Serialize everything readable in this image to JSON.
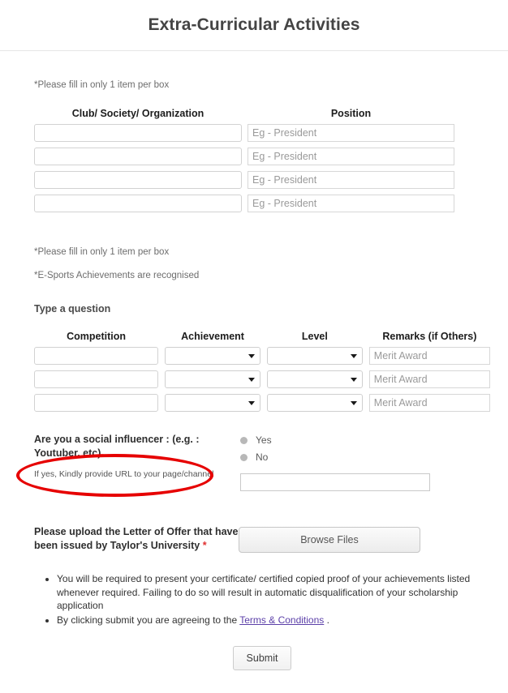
{
  "header": {
    "title": "Extra-Curricular Activities"
  },
  "notes": {
    "note1": "*Please fill in only 1 item per box",
    "note2": "*Please fill in only 1 item per box",
    "note3": "*E-Sports Achievements are recognised",
    "type_a_question": "Type a question"
  },
  "table_clubs": {
    "headers": [
      "Club/ Society/ Organization",
      "Position"
    ],
    "rows": [
      {
        "club": "",
        "club_placeholder": "",
        "position": "",
        "position_placeholder": "Eg - President"
      },
      {
        "club": "",
        "club_placeholder": "",
        "position": "",
        "position_placeholder": "Eg - President"
      },
      {
        "club": "",
        "club_placeholder": "",
        "position": "",
        "position_placeholder": "Eg - President"
      },
      {
        "club": "",
        "club_placeholder": "",
        "position": "",
        "position_placeholder": "Eg - President"
      }
    ]
  },
  "table_competitions": {
    "headers": [
      "Competition",
      "Achievement",
      "Level",
      "Remarks (if Others)"
    ],
    "rows": [
      {
        "competition": "",
        "achievement": "",
        "level": "",
        "remarks": "",
        "remarks_placeholder": "Merit Award"
      },
      {
        "competition": "",
        "achievement": "",
        "level": "",
        "remarks": "",
        "remarks_placeholder": "Merit Award"
      },
      {
        "competition": "",
        "achievement": "",
        "level": "",
        "remarks": "",
        "remarks_placeholder": "Merit Award"
      }
    ]
  },
  "influencer": {
    "question": "Are you a social influencer : (e.g. : Youtuber, etc)",
    "sub_label": "If yes, Kindly provide URL to your page/channel",
    "options": [
      "Yes",
      "No"
    ],
    "url_value": "",
    "url_placeholder": "",
    "highlight_color": "#e60000"
  },
  "upload": {
    "label": "Please upload the Letter of Offer that have been issued by Taylor's University",
    "required_mark": "*",
    "button_label": "Browse Files"
  },
  "terms": {
    "bullet1": "You will be required to present your certificate/ certified copied proof of your achievements listed whenever required. Failing to do so will result in automatic disqualification of your scholarship application",
    "bullet2_prefix": "By clicking submit you are agreeing to the ",
    "bullet2_link": "Terms & Conditions",
    "bullet2_suffix": " ."
  },
  "submit": {
    "label": "Submit"
  }
}
